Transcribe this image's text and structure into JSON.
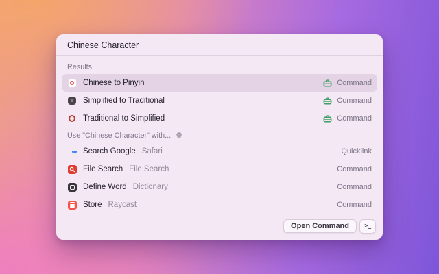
{
  "search": {
    "value": "Chinese Character"
  },
  "sections": {
    "results": {
      "header": "Results"
    },
    "use_with": {
      "header": "Use \"Chinese Character\" with..."
    }
  },
  "rows": [
    {
      "title": "Chinese to Pinyin",
      "subtitle": "",
      "accessory": "Command",
      "selected": true
    },
    {
      "title": "Simplified to Traditional",
      "subtitle": "",
      "accessory": "Command",
      "selected": false
    },
    {
      "title": "Traditional to Simplified",
      "subtitle": "",
      "accessory": "Command",
      "selected": false
    },
    {
      "title": "Search Google",
      "subtitle": "Safari",
      "accessory": "Quicklink",
      "selected": false
    },
    {
      "title": "File Search",
      "subtitle": "File Search",
      "accessory": "Command",
      "selected": false
    },
    {
      "title": "Define Word",
      "subtitle": "Dictionary",
      "accessory": "Command",
      "selected": false
    },
    {
      "title": "Store",
      "subtitle": "Raycast",
      "accessory": "Command",
      "selected": false
    }
  ],
  "footer": {
    "action": "Open Command",
    "key": ">_"
  },
  "icons": {
    "gear": "⚙"
  },
  "colors": {
    "window_bg": "#f3e8f4",
    "selected_row_bg": "#e3d3e4",
    "command_green": "#3f9e63",
    "gradient_orange": "#f4a669",
    "gradient_pink": "#f07cc5",
    "gradient_purple": "#7e56d9"
  }
}
